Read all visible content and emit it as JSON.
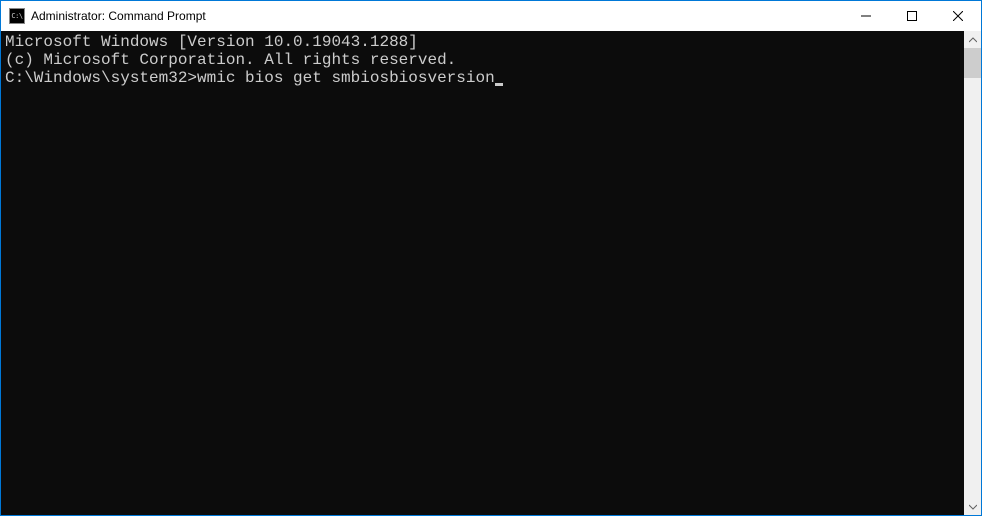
{
  "window": {
    "title": "Administrator: Command Prompt",
    "icon_label": "C:\\"
  },
  "console": {
    "line1": "Microsoft Windows [Version 10.0.19043.1288]",
    "line2": "(c) Microsoft Corporation. All rights reserved.",
    "blank": "",
    "prompt": "C:\\Windows\\system32>",
    "command": "wmic bios get smbiosbiosversion"
  }
}
